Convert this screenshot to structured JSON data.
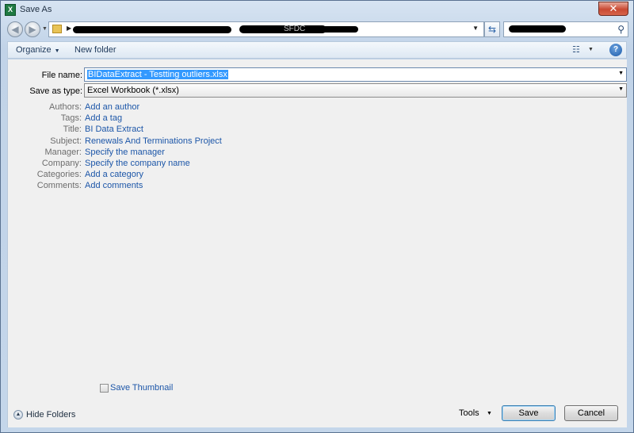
{
  "window": {
    "title": "Save As",
    "app_icon_letter": "X"
  },
  "address": {
    "folder_text": "SFDC"
  },
  "toolbar": {
    "organize_label": "Organize",
    "new_folder_label": "New folder"
  },
  "form": {
    "file_name_label": "File name:",
    "file_name_value": "BIDataExtract - Testting outliers.xlsx",
    "save_type_label": "Save as type:",
    "save_type_value": "Excel Workbook (*.xlsx)"
  },
  "metadata": [
    {
      "label": "Authors:",
      "value": "Add an author"
    },
    {
      "label": "Tags:",
      "value": "Add a tag"
    },
    {
      "label": "Title:",
      "value": "BI Data Extract"
    },
    {
      "label": "Subject:",
      "value": "Renewals And Terminations Project"
    },
    {
      "label": "Manager:",
      "value": "Specify the manager"
    },
    {
      "label": "Company:",
      "value": "Specify the company name"
    },
    {
      "label": "Categories:",
      "value": "Add a category"
    },
    {
      "label": "Comments:",
      "value": "Add comments"
    }
  ],
  "options": {
    "save_thumbnail_label": "Save Thumbnail",
    "save_thumbnail_checked": false
  },
  "footer": {
    "hide_folders_label": "Hide Folders",
    "tools_label": "Tools",
    "save_label": "Save",
    "cancel_label": "Cancel"
  },
  "colors": {
    "link_blue": "#1c56a8",
    "close_red": "#c94a33",
    "selection_blue": "#3399ff",
    "excel_green": "#1f7a42"
  }
}
